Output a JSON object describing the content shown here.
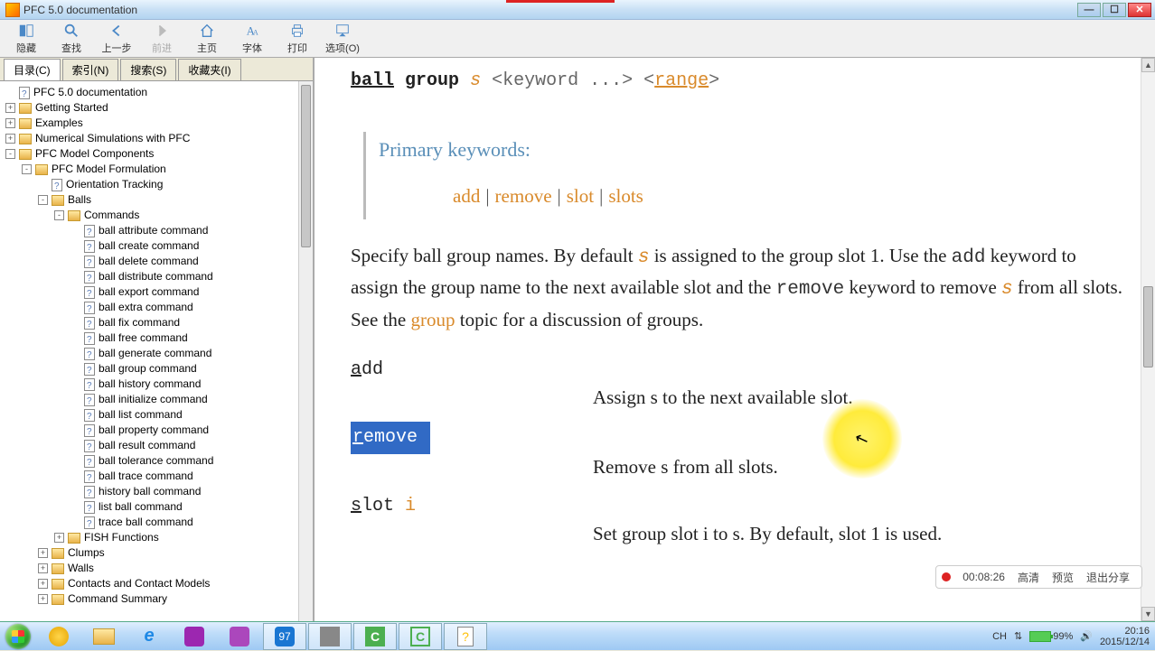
{
  "window": {
    "title": "PFC 5.0 documentation"
  },
  "toolbar": [
    {
      "name": "hide",
      "label": "隐藏"
    },
    {
      "name": "find",
      "label": "查找"
    },
    {
      "name": "back",
      "label": "上一步"
    },
    {
      "name": "forward",
      "label": "前进",
      "disabled": true
    },
    {
      "name": "home",
      "label": "主页"
    },
    {
      "name": "font",
      "label": "字体"
    },
    {
      "name": "print",
      "label": "打印"
    },
    {
      "name": "options",
      "label": "选项(O)"
    }
  ],
  "tabs": [
    {
      "name": "contents",
      "label": "目录(C)",
      "active": true
    },
    {
      "name": "index",
      "label": "索引(N)"
    },
    {
      "name": "search",
      "label": "搜索(S)"
    },
    {
      "name": "favorites",
      "label": "收藏夹(I)"
    }
  ],
  "tree": [
    {
      "d": 0,
      "t": "doc",
      "label": "PFC 5.0 documentation"
    },
    {
      "d": 0,
      "t": "fld",
      "exp": "+",
      "label": "Getting Started"
    },
    {
      "d": 0,
      "t": "fld",
      "exp": "+",
      "label": "Examples"
    },
    {
      "d": 0,
      "t": "fld",
      "exp": "+",
      "label": "Numerical Simulations with PFC"
    },
    {
      "d": 0,
      "t": "fld",
      "exp": "-",
      "label": "PFC Model Components"
    },
    {
      "d": 1,
      "t": "fld",
      "exp": "-",
      "label": "PFC Model Formulation"
    },
    {
      "d": 2,
      "t": "doc",
      "label": "Orientation Tracking"
    },
    {
      "d": 2,
      "t": "fld",
      "exp": "-",
      "label": "Balls"
    },
    {
      "d": 3,
      "t": "fld",
      "exp": "-",
      "label": "Commands"
    },
    {
      "d": 4,
      "t": "doc",
      "label": "ball attribute command"
    },
    {
      "d": 4,
      "t": "doc",
      "label": "ball create command"
    },
    {
      "d": 4,
      "t": "doc",
      "label": "ball delete command"
    },
    {
      "d": 4,
      "t": "doc",
      "label": "ball distribute command"
    },
    {
      "d": 4,
      "t": "doc",
      "label": "ball export command"
    },
    {
      "d": 4,
      "t": "doc",
      "label": "ball extra command"
    },
    {
      "d": 4,
      "t": "doc",
      "label": "ball fix command"
    },
    {
      "d": 4,
      "t": "doc",
      "label": "ball free command"
    },
    {
      "d": 4,
      "t": "doc",
      "label": "ball generate command"
    },
    {
      "d": 4,
      "t": "doc",
      "label": "ball group command"
    },
    {
      "d": 4,
      "t": "doc",
      "label": "ball history command"
    },
    {
      "d": 4,
      "t": "doc",
      "label": "ball initialize command"
    },
    {
      "d": 4,
      "t": "doc",
      "label": "ball list command"
    },
    {
      "d": 4,
      "t": "doc",
      "label": "ball property command"
    },
    {
      "d": 4,
      "t": "doc",
      "label": "ball result command"
    },
    {
      "d": 4,
      "t": "doc",
      "label": "ball tolerance command"
    },
    {
      "d": 4,
      "t": "doc",
      "label": "ball trace command"
    },
    {
      "d": 4,
      "t": "doc",
      "label": "history ball command"
    },
    {
      "d": 4,
      "t": "doc",
      "label": "list ball command"
    },
    {
      "d": 4,
      "t": "doc",
      "label": "trace ball command"
    },
    {
      "d": 3,
      "t": "fld",
      "exp": "+",
      "label": "FISH Functions"
    },
    {
      "d": 2,
      "t": "fld",
      "exp": "+",
      "label": "Clumps"
    },
    {
      "d": 2,
      "t": "fld",
      "exp": "+",
      "label": "Walls"
    },
    {
      "d": 2,
      "t": "fld",
      "exp": "+",
      "label": "Contacts and Contact Models"
    },
    {
      "d": 2,
      "t": "fld",
      "exp": "+",
      "label": "Command Summary"
    }
  ],
  "content": {
    "cmd": {
      "b": "ball",
      "g": "group",
      "s": "s",
      "kw": "<keyword ...>",
      "r": "range"
    },
    "primary": {
      "title": "Primary keywords:",
      "items": [
        "add",
        "remove",
        "slot",
        "slots"
      ]
    },
    "para": {
      "p1a": "Specify ball group names. By default ",
      "p1s": "s",
      "p1b": " is assigned to the group slot 1. Use the ",
      "p1add": "add",
      "p1c": " keyword to assign the group name to the next available slot and the ",
      "p1rem": "remove",
      "p1d": " keyword to remove ",
      "p1s2": "s",
      "p1e": " from all slots. See the ",
      "p1grp": "group",
      "p1f": " topic for a discussion of groups."
    },
    "defs": {
      "add": {
        "name": "add",
        "u": "a",
        "rest": "dd",
        "text_a": "Assign ",
        "s": "s",
        "text_b": " to the next available slot."
      },
      "remove": {
        "name": "remove",
        "u": "r",
        "rest": "emove",
        "text_a": "Remove ",
        "s": "s",
        "text_b": " from all slots."
      },
      "slot": {
        "name": "slot",
        "u": "s",
        "rest": "lot",
        "arg": "i",
        "text_a": "Set group slot ",
        "i": "i",
        "text_b": " to ",
        "s": "s",
        "text_c": ". By default, slot 1 is used."
      }
    }
  },
  "overlay": {
    "time": "00:08:26",
    "hq": "高清",
    "preview": "预览",
    "exit": "退出分享"
  },
  "systray": {
    "ime": "CH",
    "net_icon": "⇅",
    "battery": "99%",
    "vol_icon": "🔊",
    "time": "20:16",
    "date": "2015/12/14"
  }
}
